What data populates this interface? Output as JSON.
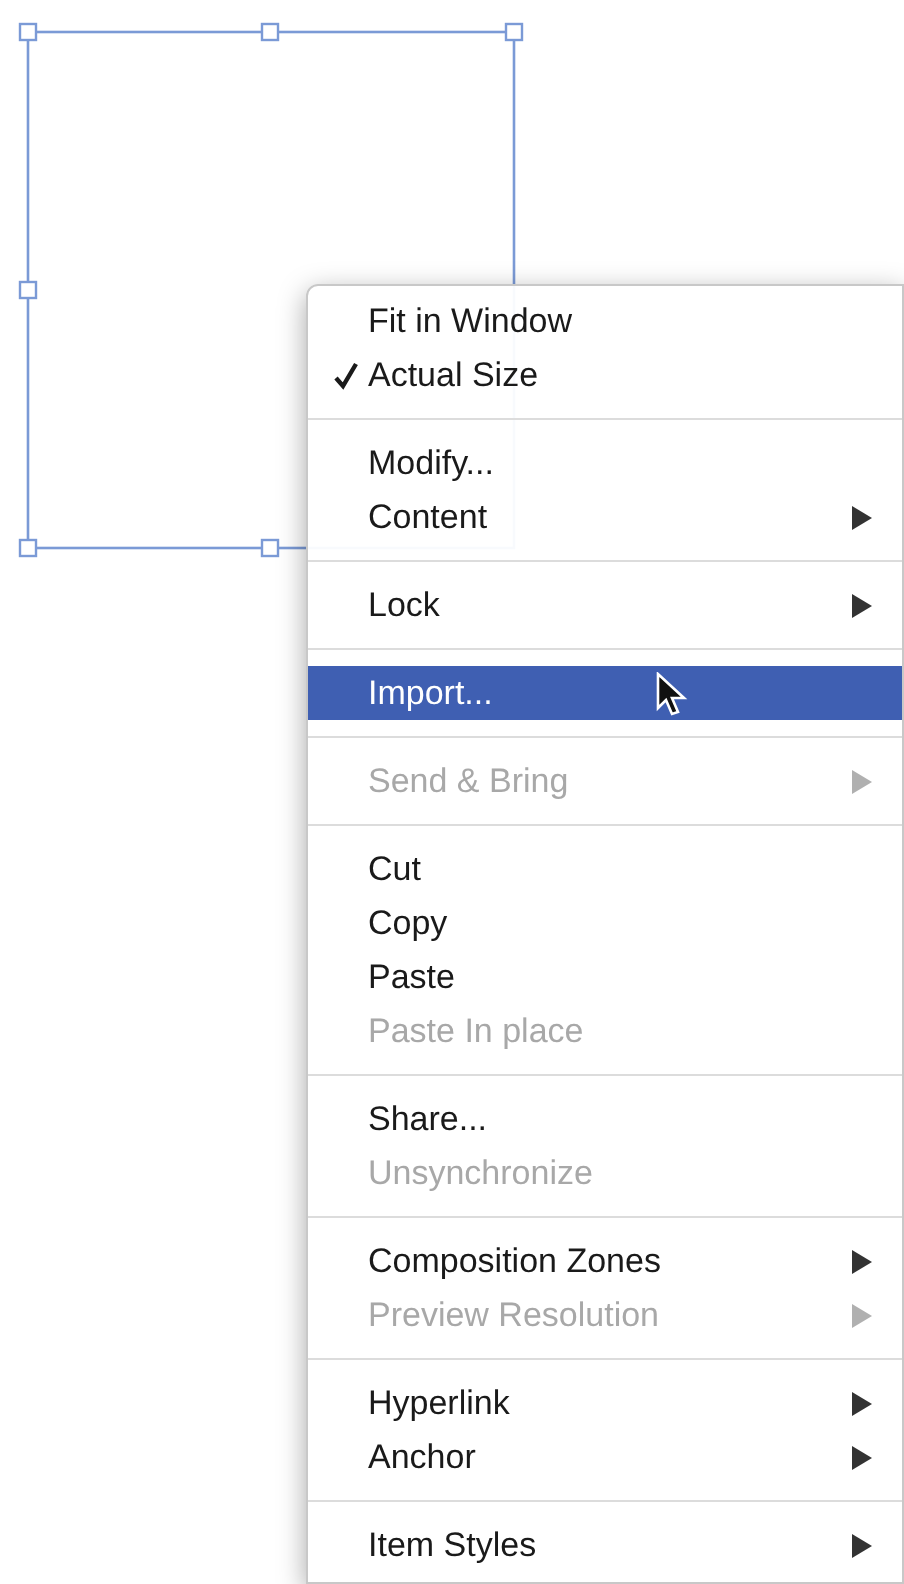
{
  "frame": {
    "selected": true
  },
  "menu": [
    {
      "kind": "item",
      "label": "Fit in Window",
      "checked": false,
      "disabled": false,
      "submenu": false,
      "selected": false
    },
    {
      "kind": "item",
      "label": "Actual Size",
      "checked": true,
      "disabled": false,
      "submenu": false,
      "selected": false
    },
    {
      "kind": "separator"
    },
    {
      "kind": "item",
      "label": "Modify...",
      "checked": false,
      "disabled": false,
      "submenu": false,
      "selected": false
    },
    {
      "kind": "item",
      "label": "Content",
      "checked": false,
      "disabled": false,
      "submenu": true,
      "selected": false
    },
    {
      "kind": "separator"
    },
    {
      "kind": "item",
      "label": "Lock",
      "checked": false,
      "disabled": false,
      "submenu": true,
      "selected": false
    },
    {
      "kind": "separator"
    },
    {
      "kind": "item",
      "label": "Import...",
      "checked": false,
      "disabled": false,
      "submenu": false,
      "selected": true
    },
    {
      "kind": "separator"
    },
    {
      "kind": "item",
      "label": "Send & Bring",
      "checked": false,
      "disabled": true,
      "submenu": true,
      "selected": false
    },
    {
      "kind": "separator"
    },
    {
      "kind": "item",
      "label": "Cut",
      "checked": false,
      "disabled": false,
      "submenu": false,
      "selected": false
    },
    {
      "kind": "item",
      "label": "Copy",
      "checked": false,
      "disabled": false,
      "submenu": false,
      "selected": false
    },
    {
      "kind": "item",
      "label": "Paste",
      "checked": false,
      "disabled": false,
      "submenu": false,
      "selected": false
    },
    {
      "kind": "item",
      "label": "Paste In place",
      "checked": false,
      "disabled": true,
      "submenu": false,
      "selected": false
    },
    {
      "kind": "separator"
    },
    {
      "kind": "item",
      "label": "Share...",
      "checked": false,
      "disabled": false,
      "submenu": false,
      "selected": false
    },
    {
      "kind": "item",
      "label": "Unsynchronize",
      "checked": false,
      "disabled": true,
      "submenu": false,
      "selected": false
    },
    {
      "kind": "separator"
    },
    {
      "kind": "item",
      "label": "Composition Zones",
      "checked": false,
      "disabled": false,
      "submenu": true,
      "selected": false
    },
    {
      "kind": "item",
      "label": "Preview Resolution",
      "checked": false,
      "disabled": true,
      "submenu": true,
      "selected": false
    },
    {
      "kind": "separator"
    },
    {
      "kind": "item",
      "label": "Hyperlink",
      "checked": false,
      "disabled": false,
      "submenu": true,
      "selected": false
    },
    {
      "kind": "item",
      "label": "Anchor",
      "checked": false,
      "disabled": false,
      "submenu": true,
      "selected": false
    },
    {
      "kind": "separator"
    },
    {
      "kind": "item",
      "label": "Item Styles",
      "checked": false,
      "disabled": false,
      "submenu": true,
      "selected": false
    }
  ]
}
